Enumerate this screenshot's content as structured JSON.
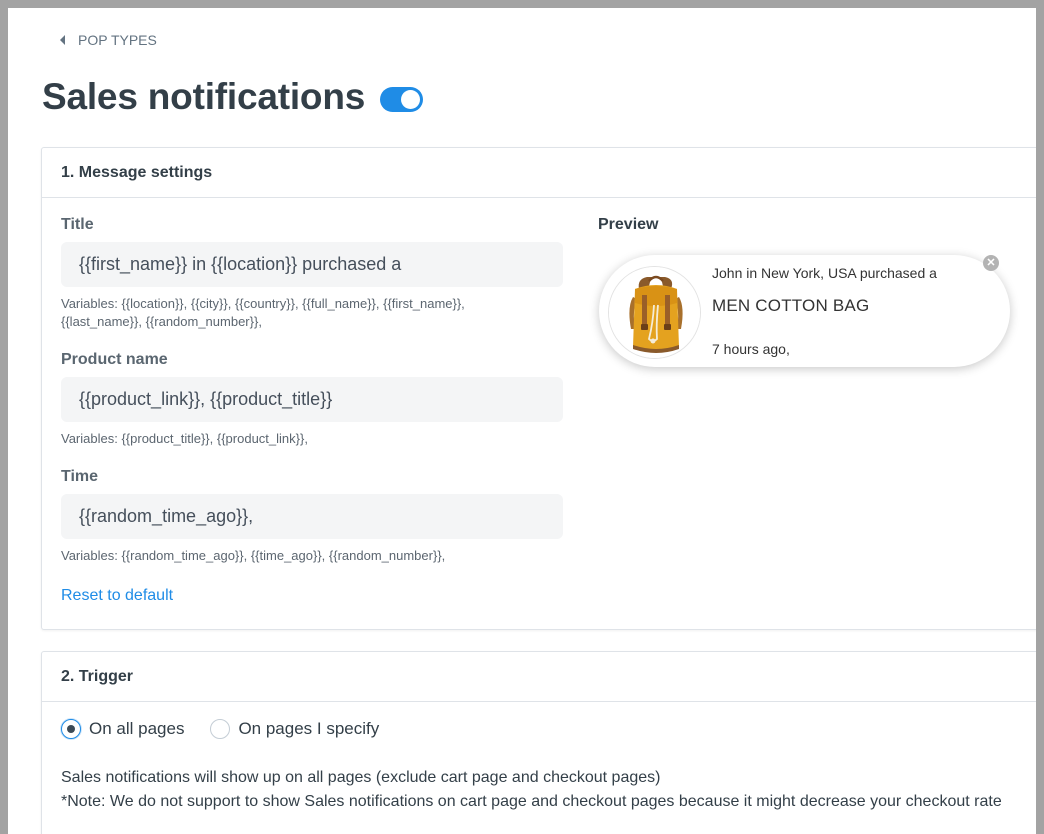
{
  "breadcrumb": {
    "label": "POP TYPES"
  },
  "page": {
    "title": "Sales notifications",
    "enabled": true,
    "accent": "#1f8ce6"
  },
  "message_settings": {
    "header": "1. Message settings",
    "title_field": {
      "label": "Title",
      "value": "{{first_name}} in {{location}} purchased a",
      "hint": "Variables: {{location}}, {{city}}, {{country}}, {{full_name}}, {{first_name}}, {{last_name}}, {{random_number}},"
    },
    "product_field": {
      "label": "Product name",
      "value": "{{product_link}}, {{product_title}}",
      "hint": "Variables: {{product_title}}, {{product_link}},"
    },
    "time_field": {
      "label": "Time",
      "value": "{{random_time_ago}},",
      "hint": "Variables: {{random_time_ago}}, {{time_ago}}, {{random_number}},"
    },
    "reset_label": "Reset to default",
    "preview": {
      "label": "Preview",
      "line1": "John in New York, USA purchased a",
      "product": "MEN COTTON BAG",
      "time": "7 hours ago,",
      "image_icon": "backpack-image",
      "close_icon": "close-icon"
    }
  },
  "trigger": {
    "header": "2. Trigger",
    "options": [
      {
        "label": "On all pages",
        "selected": true
      },
      {
        "label": "On pages I specify",
        "selected": false
      }
    ],
    "description": "Sales notifications will show up on all pages (exclude cart page and checkout pages)",
    "note": "*Note: We do not support to show Sales notifications on cart page and checkout pages because it might decrease your checkout rate"
  }
}
